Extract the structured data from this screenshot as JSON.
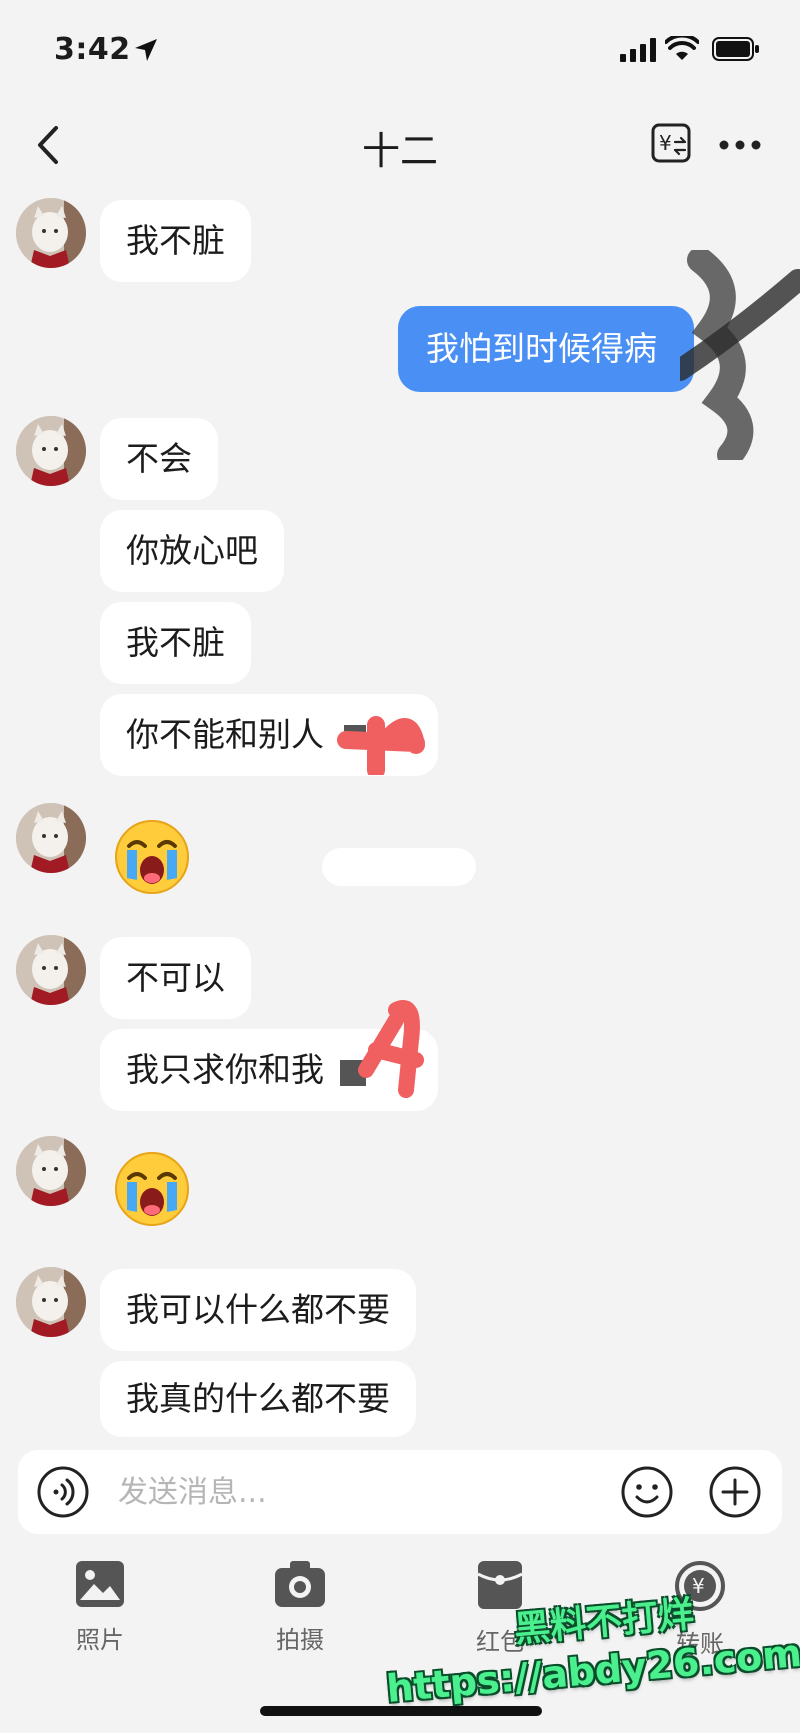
{
  "status_bar": {
    "time": "3:42"
  },
  "nav": {
    "title": "十二"
  },
  "messages": {
    "m1": "我不脏",
    "m2_out": "我怕到时候得病",
    "m3": "不会",
    "m4": "你放心吧",
    "m5": "我不脏",
    "m6": "你不能和别人",
    "m8": "不可以",
    "m9": "我只求你和我",
    "m11": "我可以什么都不要",
    "m12": "我真的什么都不要"
  },
  "input": {
    "placeholder": "发送消息..."
  },
  "toolbar": {
    "photo": "照片",
    "camera": "拍摄",
    "redpacket": "红包",
    "transfer": "转账"
  },
  "watermark": {
    "line1": "黑料不打烊",
    "line2": "https://abdy26.com"
  },
  "colors": {
    "background": "#f3f3f3",
    "outgoing_bubble": "#4a8ff4",
    "incoming_bubble": "#ffffff",
    "watermark": "#4bf08e"
  },
  "icons": [
    "back-icon",
    "exchange-icon",
    "more-icon",
    "voice-icon",
    "smile-icon",
    "plus-icon",
    "photo-icon",
    "camera-icon",
    "redpacket-icon",
    "transfer-icon",
    "crying-emoji"
  ]
}
